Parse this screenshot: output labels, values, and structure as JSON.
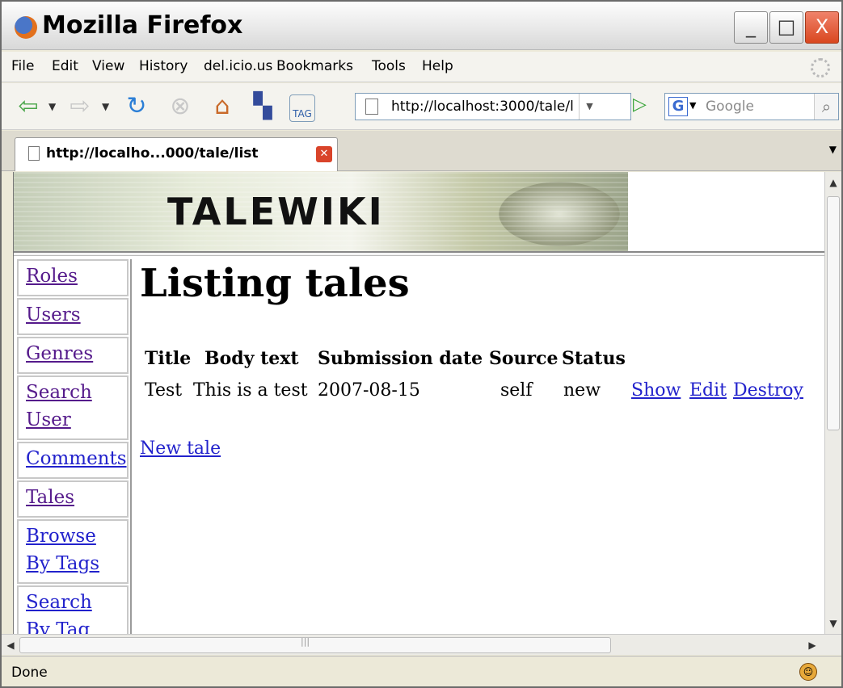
{
  "window": {
    "title": "Mozilla Firefox",
    "minimize_label": "_",
    "maximize_label": "□",
    "close_label": "X"
  },
  "menu": {
    "file": "File",
    "edit": "Edit",
    "view": "View",
    "history": "History",
    "delicious": "del.icio.us",
    "bookmarks": "Bookmarks",
    "tools": "Tools",
    "help": "Help"
  },
  "toolbar": {
    "icons": [
      "back-arrow-icon",
      "forward-arrow-icon",
      "reload-icon",
      "stop-icon",
      "home-icon",
      "delicious-icon",
      "tag-icon",
      "go-arrow-icon",
      "google-icon",
      "magnifier-icon"
    ],
    "tag_label": "TAG",
    "url": "http://localhost:3000/tale/l",
    "search_engine": "G",
    "search_placeholder": "Google"
  },
  "tab": {
    "label": "http://localho...000/tale/list"
  },
  "banner": {
    "text": "TALEWIKI"
  },
  "sidebar": {
    "items": [
      {
        "label": "Roles"
      },
      {
        "label": "Users"
      },
      {
        "label": "Genres"
      },
      {
        "label": "Search User"
      },
      {
        "label": "Comments"
      },
      {
        "label": "Tales"
      },
      {
        "label": "Browse By Tags"
      },
      {
        "label": "Search By Tag"
      }
    ]
  },
  "main": {
    "heading": "Listing tales",
    "columns": [
      "Title",
      "Body text",
      "Submission date",
      "Source",
      "Status"
    ],
    "rows": [
      {
        "title": "Test",
        "body_text": "This is a test",
        "submission_date": "2007-08-15",
        "source": "self",
        "status": "new",
        "show": "Show",
        "edit": "Edit",
        "destroy": "Destroy"
      }
    ],
    "new_tale": "New tale"
  },
  "status": {
    "text": "Done"
  },
  "colors": {
    "link": "#2222cc",
    "visited_link": "#551a8b"
  }
}
